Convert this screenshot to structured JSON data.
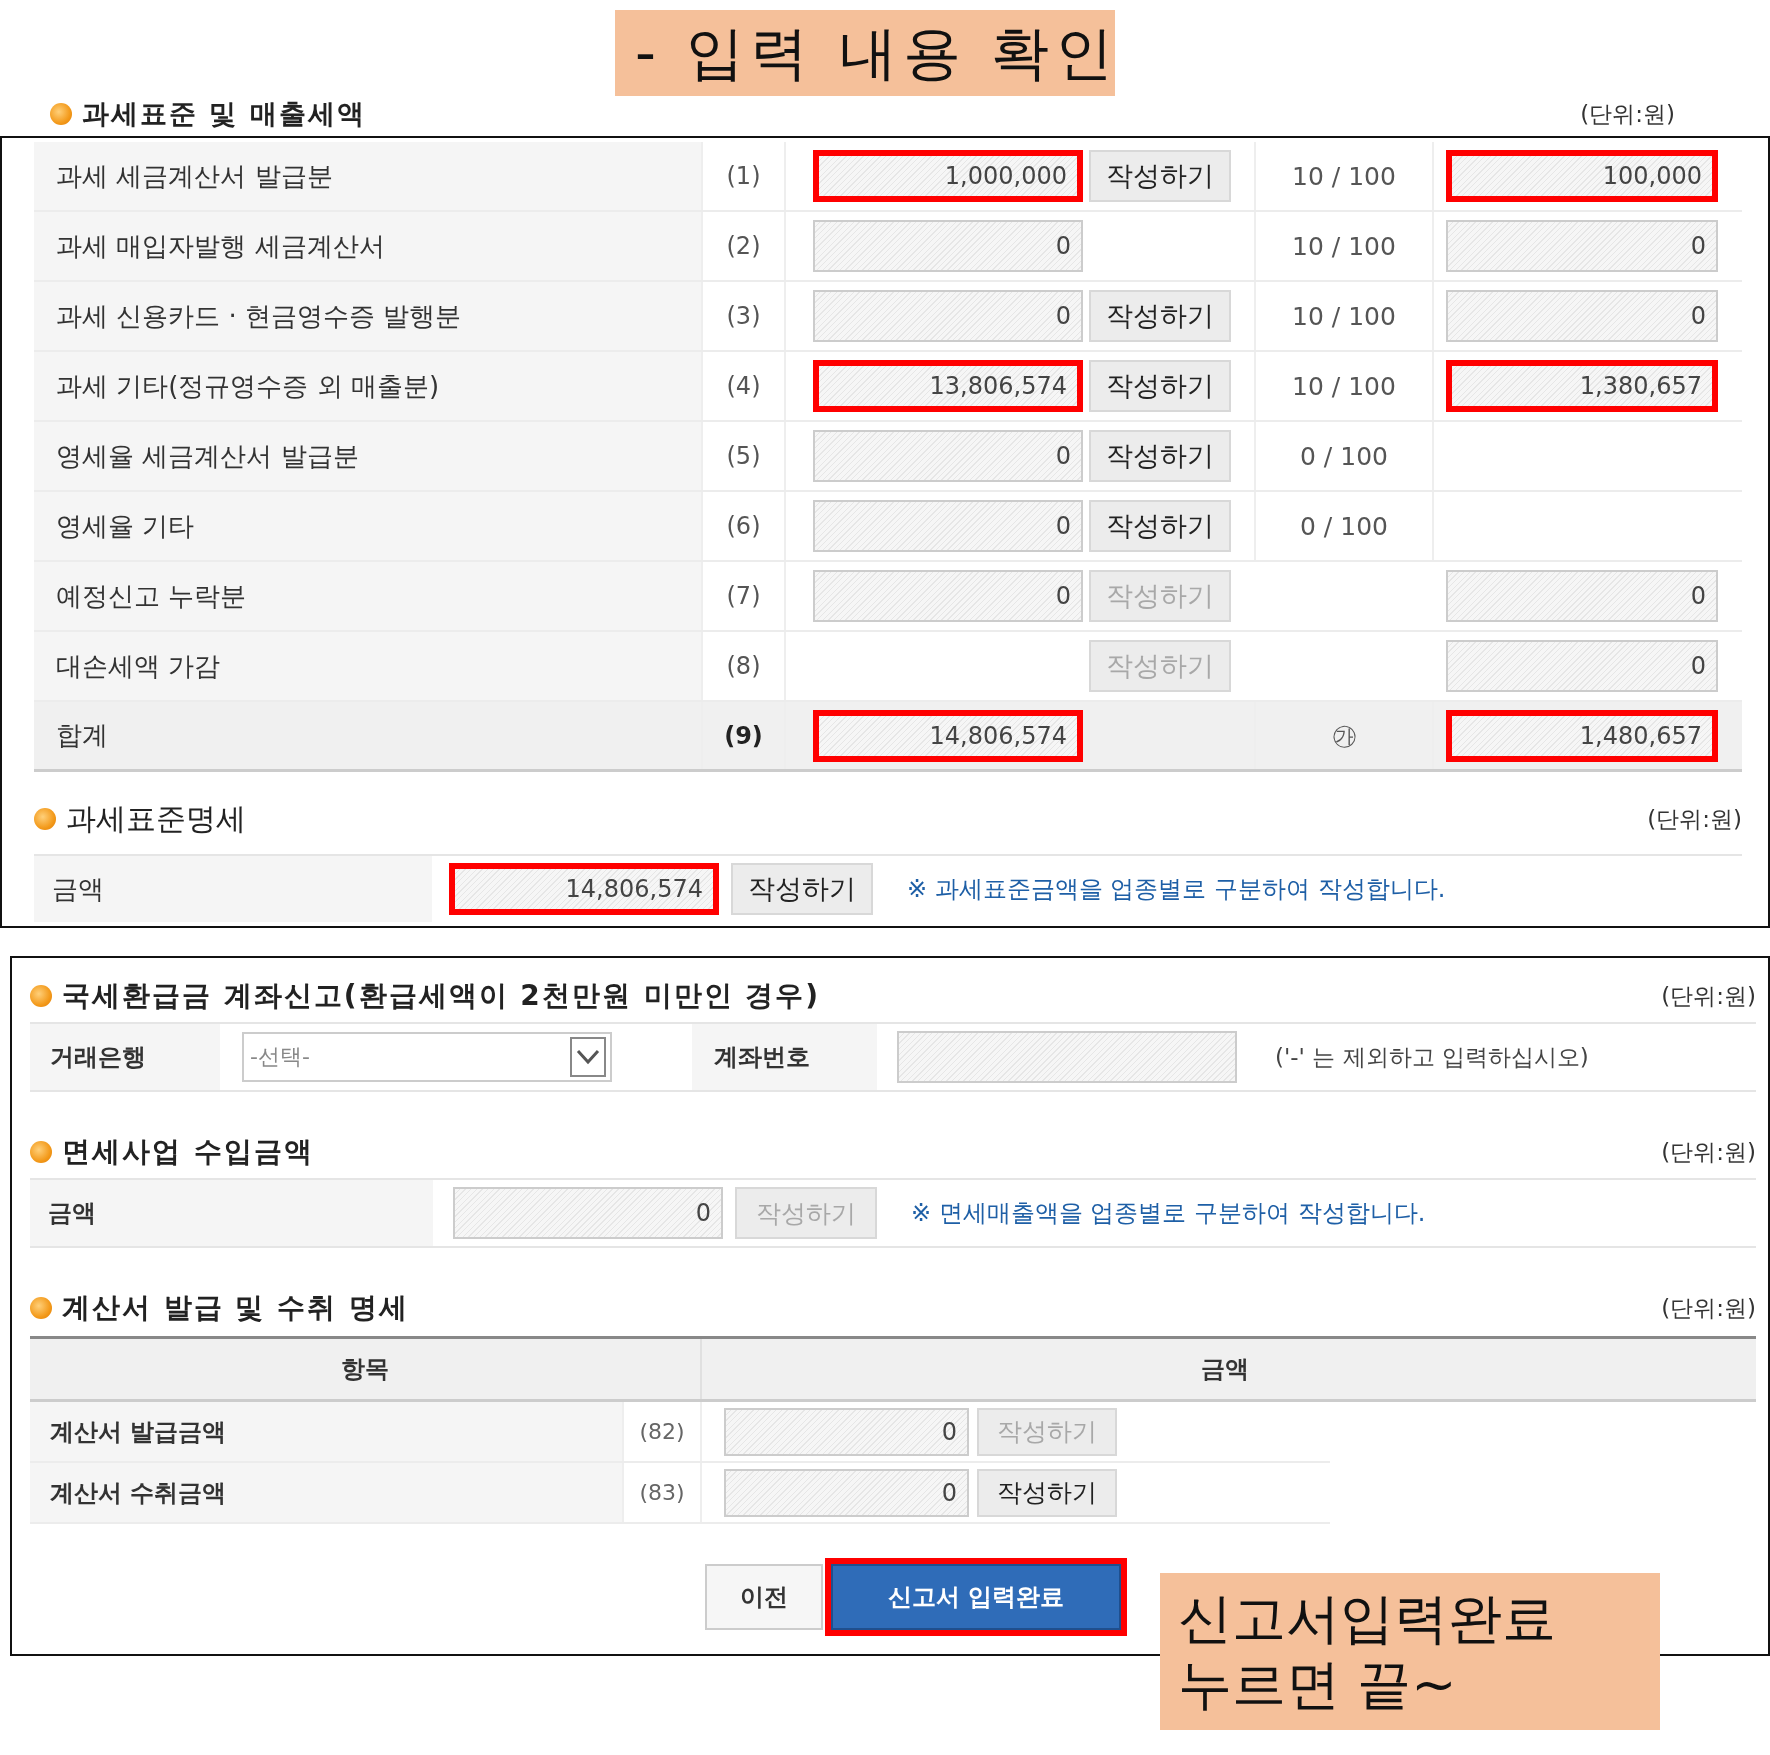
{
  "banner": {
    "text": "- 입력 내용 확인"
  },
  "tax_base": {
    "title": "과세표준 및 매출세액",
    "unit": "(단위:원)",
    "rows": [
      {
        "kind": "item",
        "label": "과세 세금계산서 발급분",
        "number": "(1)",
        "amount": {
          "value": "1,000,000",
          "highlighted": true
        },
        "button": {
          "label": "작성하기",
          "disabled": false
        },
        "rate": "10 / 100",
        "tax": {
          "value": "100,000",
          "highlighted": true
        }
      },
      {
        "kind": "item",
        "label": "과세 매입자발행 세금계산서",
        "number": "(2)",
        "amount": {
          "value": "0",
          "highlighted": false
        },
        "rate": "10 / 100",
        "tax": {
          "value": "0",
          "highlighted": false
        }
      },
      {
        "kind": "item",
        "label": "과세 신용카드 · 현금영수증 발행분",
        "number": "(3)",
        "amount": {
          "value": "0",
          "highlighted": false
        },
        "button": {
          "label": "작성하기",
          "disabled": false
        },
        "rate": "10 / 100",
        "tax": {
          "value": "0",
          "highlighted": false
        }
      },
      {
        "kind": "item",
        "label": "과세 기타(정규영수증 외 매출분)",
        "number": "(4)",
        "amount": {
          "value": "13,806,574",
          "highlighted": true
        },
        "button": {
          "label": "작성하기",
          "disabled": false
        },
        "rate": "10 / 100",
        "tax": {
          "value": "1,380,657",
          "highlighted": true
        }
      },
      {
        "kind": "item",
        "label": "영세율 세금계산서 발급분",
        "number": "(5)",
        "amount": {
          "value": "0",
          "highlighted": false
        },
        "button": {
          "label": "작성하기",
          "disabled": false
        },
        "rate": "0 / 100"
      },
      {
        "kind": "item",
        "label": "영세율 기타",
        "number": "(6)",
        "amount": {
          "value": "0",
          "highlighted": false
        },
        "button": {
          "label": "작성하기",
          "disabled": false
        },
        "rate": "0 / 100"
      },
      {
        "kind": "item",
        "label": "예정신고 누락분",
        "number": "(7)",
        "amount": {
          "value": "0",
          "highlighted": false
        },
        "button": {
          "label": "작성하기",
          "disabled": true
        },
        "tax": {
          "value": "0",
          "highlighted": false
        }
      },
      {
        "kind": "item",
        "label": "대손세액 가감",
        "number": "(8)",
        "button": {
          "label": "작성하기",
          "disabled": true
        },
        "tax": {
          "value": "0",
          "highlighted": false
        }
      },
      {
        "kind": "total",
        "label": "합계",
        "number": "(9)",
        "amount": {
          "value": "14,806,574",
          "highlighted": true
        },
        "rate": "㉮",
        "tax": {
          "value": "1,480,657",
          "highlighted": true
        }
      }
    ]
  },
  "tax_base_detail": {
    "title": "과세표준명세",
    "unit": "(단위:원)",
    "label": "금액",
    "amount": {
      "value": "14,806,574",
      "highlighted": true
    },
    "button": {
      "label": "작성하기",
      "disabled": false
    },
    "note": "※ 과세표준금액을 업종별로 구분하여 작성합니다."
  },
  "refund_account": {
    "title": "국세환급금 계좌신고(환급세액이 2천만원 미만인 경우)",
    "unit": "(단위:원)",
    "bank_label": "거래은행",
    "bank_select": "-선택-",
    "account_label": "계좌번호",
    "note": "('-' 는 제외하고 입력하십시오)"
  },
  "exempt_income": {
    "title": "면세사업 수입금액",
    "unit": "(단위:원)",
    "label": "금액",
    "amount": {
      "value": "0",
      "highlighted": false
    },
    "button": {
      "label": "작성하기",
      "disabled": true
    },
    "note": "※ 면세매출액을 업종별로 구분하여 작성합니다."
  },
  "invoices": {
    "title": "계산서 발급 및 수취 명세",
    "unit": "(단위:원)",
    "columns": [
      "항목",
      "금액"
    ],
    "rows": [
      {
        "label": "계산서 발급금액",
        "number": "(82)",
        "amount": {
          "value": "0",
          "highlighted": false
        },
        "button": {
          "label": "작성하기",
          "disabled": true
        }
      },
      {
        "label": "계산서 수취금액",
        "number": "(83)",
        "amount": {
          "value": "0",
          "highlighted": false
        },
        "button": {
          "label": "작성하기",
          "disabled": false
        }
      }
    ]
  },
  "actions": [
    {
      "label": "이전",
      "kind": "secondary",
      "highlighted": false
    },
    {
      "label": "신고서 입력완료",
      "kind": "primary",
      "highlighted": true
    }
  ],
  "callout": {
    "lines": [
      "신고서입력완료",
      "누르면 끝~"
    ]
  }
}
